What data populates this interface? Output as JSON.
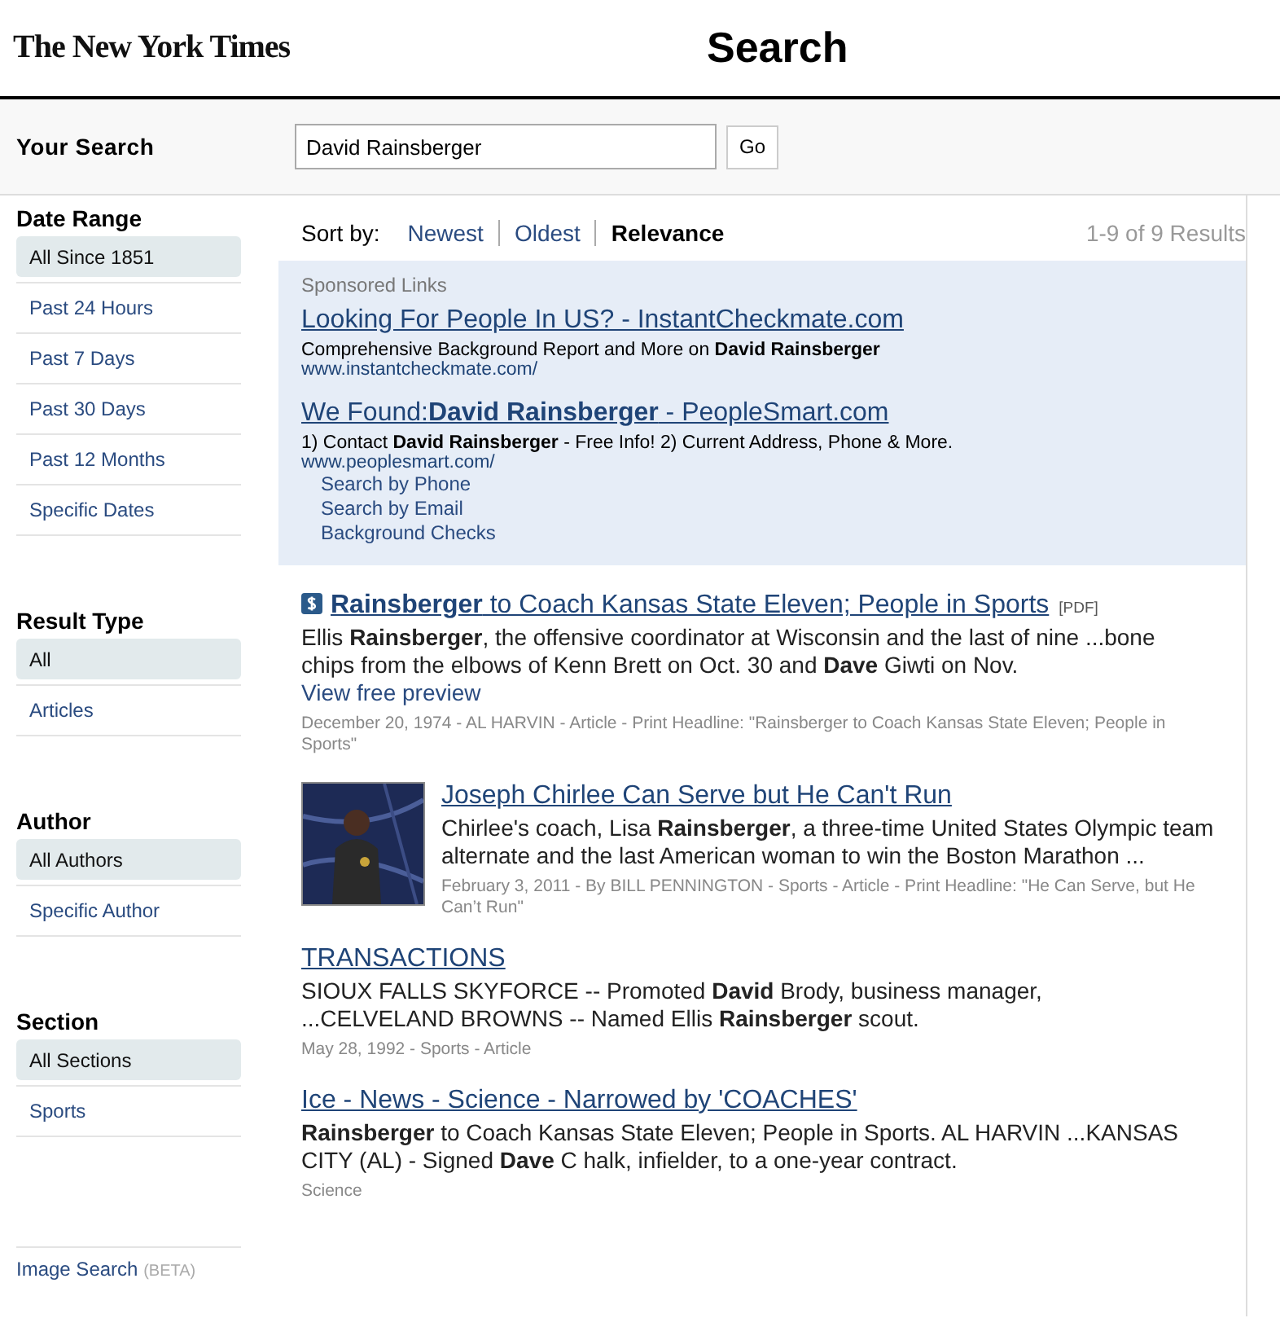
{
  "header": {
    "logo": "The New York Times",
    "title": "Search"
  },
  "search": {
    "label": "Your Search",
    "value": "David Rainsberger",
    "button": "Go"
  },
  "filters": [
    {
      "heading": "Date Range",
      "items": [
        {
          "label": "All Since 1851",
          "selected": true
        },
        {
          "label": "Past 24 Hours",
          "selected": false
        },
        {
          "label": "Past 7 Days",
          "selected": false
        },
        {
          "label": "Past 30 Days",
          "selected": false
        },
        {
          "label": "Past 12 Months",
          "selected": false
        },
        {
          "label": "Specific Dates",
          "selected": false
        }
      ]
    },
    {
      "heading": "Result Type",
      "items": [
        {
          "label": "All",
          "selected": true
        },
        {
          "label": "Articles",
          "selected": false
        }
      ]
    },
    {
      "heading": "Author",
      "items": [
        {
          "label": "All Authors",
          "selected": true
        },
        {
          "label": "Specific Author",
          "selected": false
        }
      ]
    },
    {
      "heading": "Section",
      "items": [
        {
          "label": "All Sections",
          "selected": true
        },
        {
          "label": "Sports",
          "selected": false
        }
      ]
    }
  ],
  "image_search": {
    "label": "Image Search",
    "tag": "(BETA)"
  },
  "sort": {
    "label": "Sort by:",
    "options": [
      {
        "label": "Newest",
        "selected": false
      },
      {
        "label": "Oldest",
        "selected": false
      },
      {
        "label": "Relevance",
        "selected": true
      }
    ],
    "count": "1-9 of 9 Results"
  },
  "sponsored": {
    "heading": "Sponsored Links",
    "ads": [
      {
        "title": "Looking For People In US? - InstantCheckmate.com",
        "text": "Comprehensive Background Report and More on **David Rainsberger**",
        "url": "www.instantcheckmate.com/"
      },
      {
        "title": "We Found:**David Rainsberger** - PeopleSmart.com",
        "text": "1) Contact **David Rainsberger** - Free Info! 2) Current Address, Phone & More.",
        "url": "www.peoplesmart.com/",
        "sublinks": [
          "Search by Phone",
          "Search by Email",
          "Background Checks"
        ]
      }
    ]
  },
  "results": [
    {
      "kind": "paid",
      "title": "**Rainsberger** to Coach Kansas State Eleven; People in Sports",
      "tag": "[PDF]",
      "snippet": "Ellis **Rainsberger**, the offensive coordinator at Wisconsin and the last of nine ...bone chips from the elbows of Kenn Brett on Oct. 30 and **Dave** Giwti on Nov.",
      "link": "View free preview",
      "meta": "December 20, 1974 - AL HARVIN - Article - Print Headline: \"Rainsberger to Coach Kansas State Eleven; People in Sports\""
    },
    {
      "title": "Joseph Chirlee Can Serve but He Can't Run",
      "snippet": "Chirlee's coach, Lisa **Rainsberger**, a three-time United States Olympic team alternate and the last American woman to win the Boston Marathon ...",
      "meta": "February 3, 2011 - By BILL PENNINGTON - Sports - Article - Print Headline: \"He Can Serve, but He Can’t Run\""
    },
    {
      "kind": "plain",
      "title": "TRANSACTIONS",
      "snippet": "SIOUX FALLS SKYFORCE -- Promoted **David** Brody, business manager, ...CELVELAND BROWNS -- Named Ellis **Rainsberger** scout.",
      "meta": "May 28, 1992 - Sports - Article"
    },
    {
      "kind": "plain",
      "title": "Ice - News - Science - Narrowed by 'COACHES'",
      "snippet": "**Rainsberger** to Coach Kansas State Eleven; People in Sports. AL HARVIN ...KANSAS CITY (AL) - Signed **Dave** C halk, infielder, to a one-year contract.",
      "meta": "Science"
    }
  ]
}
